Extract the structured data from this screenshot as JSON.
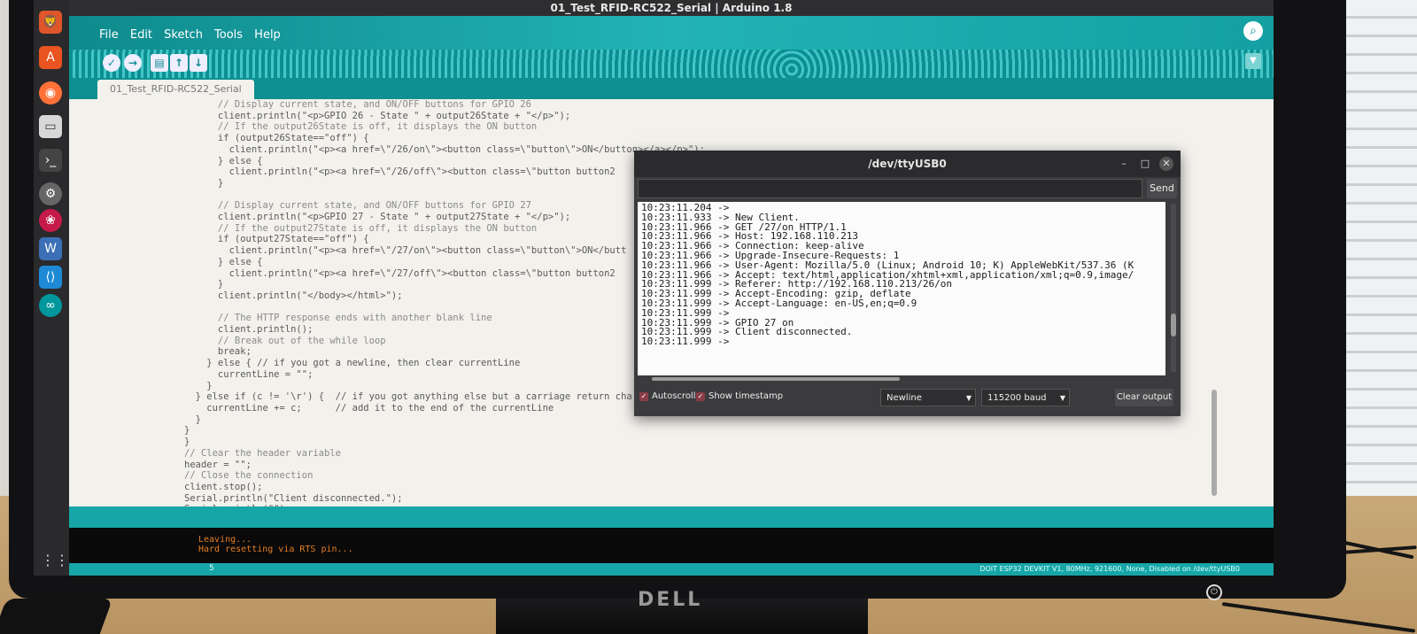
{
  "window": {
    "title": "01_Test_RFID-RC522_Serial | Arduino 1.8"
  },
  "menu": [
    "File",
    "Edit",
    "Sketch",
    "Tools",
    "Help"
  ],
  "toolbar": {
    "verify_icon": "check-icon",
    "upload_icon": "arrow-right-icon",
    "new_icon": "file-icon",
    "open_icon": "arrow-up-icon",
    "save_icon": "arrow-down-icon"
  },
  "tab": {
    "label": "01_Test_RFID-RC522_Serial"
  },
  "editor": {
    "lines": [
      "      // Display current state, and ON/OFF buttons for GPIO 26",
      "      client.println(\"<p>GPIO 26 - State \" + output26State + \"</p>\");",
      "      // If the output26State is off, it displays the ON button",
      "      if (output26State==\"off\") {",
      "        client.println(\"<p><a href=\\\"/26/on\\\"><button class=\\\"button\\\">ON</button></a></p>\");",
      "      } else {",
      "        client.println(\"<p><a href=\\\"/26/off\\\"><button class=\\\"button button2",
      "      }",
      "",
      "      // Display current state, and ON/OFF buttons for GPIO 27",
      "      client.println(\"<p>GPIO 27 - State \" + output27State + \"</p>\");",
      "      // If the output27State is off, it displays the ON button",
      "      if (output27State==\"off\") {",
      "        client.println(\"<p><a href=\\\"/27/on\\\"><button class=\\\"button\\\">ON</butt",
      "      } else {",
      "        client.println(\"<p><a href=\\\"/27/off\\\"><button class=\\\"button button2",
      "      }",
      "      client.println(\"</body></html>\");",
      "",
      "      // The HTTP response ends with another blank line",
      "      client.println();",
      "      // Break out of the while loop",
      "      break;",
      "    } else { // if you got a newline, then clear currentLine",
      "      currentLine = \"\";",
      "    }",
      "  } else if (c != '\\r') {  // if you got anything else but a carriage return cha",
      "    currentLine += c;      // add it to the end of the currentLine",
      "  }",
      "}",
      "}",
      "// Clear the header variable",
      "header = \"\";",
      "// Close the connection",
      "client.stop();",
      "Serial.println(\"Client disconnected.\");",
      "Serial.println(\"\");",
      "}"
    ]
  },
  "console": {
    "lines": [
      "Leaving...",
      "Hard resetting via RTS pin..."
    ]
  },
  "status": {
    "line": "5",
    "board": "DOIT ESP32 DEVKIT V1, 80MHz, 921600, None, Disabled on /dev/ttyUSB0"
  },
  "serial_monitor": {
    "title": "/dev/ttyUSB0",
    "send_label": "Send",
    "input_value": "",
    "output_lines": [
      "10:23:11.204 -> ",
      "10:23:11.933 -> New Client.",
      "10:23:11.966 -> GET /27/on HTTP/1.1",
      "10:23:11.966 -> Host: 192.168.110.213",
      "10:23:11.966 -> Connection: keep-alive",
      "10:23:11.966 -> Upgrade-Insecure-Requests: 1",
      "10:23:11.966 -> User-Agent: Mozilla/5.0 (Linux; Android 10; K) AppleWebKit/537.36 (K",
      "10:23:11.966 -> Accept: text/html,application/xhtml+xml,application/xml;q=0.9,image/",
      "10:23:11.999 -> Referer: http://192.168.110.213/26/on",
      "10:23:11.999 -> Accept-Encoding: gzip, deflate",
      "10:23:11.999 -> Accept-Language: en-US,en;q=0.9",
      "10:23:11.999 -> ",
      "10:23:11.999 -> GPIO 27 on",
      "10:23:11.999 -> Client disconnected.",
      "10:23:11.999 -> "
    ],
    "autoscroll_label": "Autoscroll",
    "autoscroll_checked": true,
    "timestamp_label": "Show timestamp",
    "timestamp_checked": true,
    "line_ending": "Newline",
    "baud": "115200 baud",
    "clear_label": "Clear output",
    "window_controls": [
      "minimize-icon",
      "maximize-icon",
      "close-icon"
    ]
  },
  "monitor_brand": "DELL",
  "colors": {
    "arduino_teal": "#17a6a8",
    "console_orange": "#e67e22",
    "dock": "#2a2a2d"
  }
}
